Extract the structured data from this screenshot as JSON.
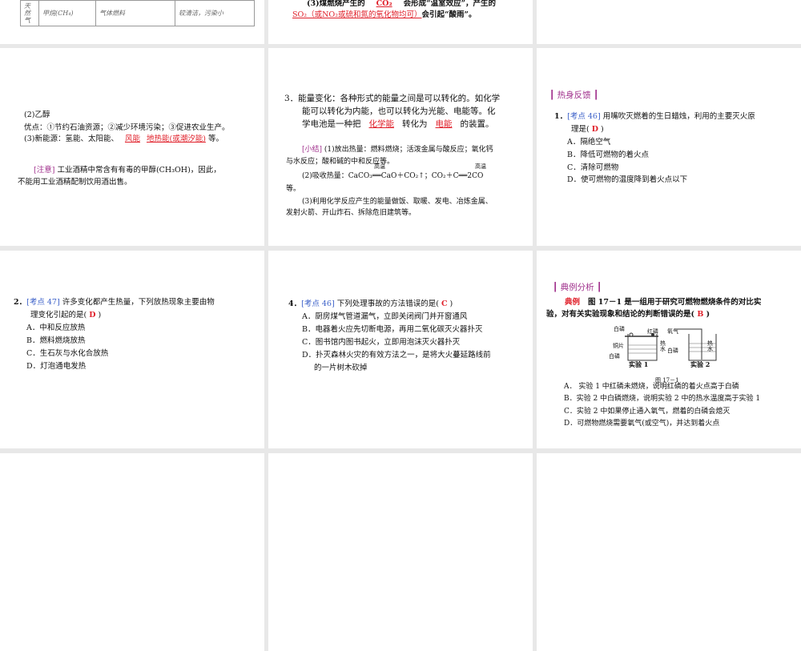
{
  "slides": {
    "s1": {
      "table": {
        "c0": "天然气",
        "c1": "甲烷(CH₄)",
        "c2": "气体燃料",
        "c3": "较清洁，污染小"
      }
    },
    "s2": {
      "pre": "(3)煤燃烧产生的",
      "a1": "CO₂",
      "mid": "会形成“温室效应”，产生的",
      "a2": "SO₂（或NO₂或硫和氮的氧化物均可）",
      "post": "会引起“酸雨”。"
    },
    "s4": {
      "l1": "(2)乙醇",
      "l2": "优点：①节约石油资源；②减少环境污染；③促进农业生产。",
      "l3pre": "(3)新能源：氢能、太阳能、",
      "a1": "风能",
      "a2": "地热能(或潮汐能)",
      "l3post": "等。",
      "note_tag": "[注意]",
      "note1": "工业酒精中常含有有毒的甲醇(CH₃OH)，因此，",
      "note2": "不能用工业酒精配制饮用酒出售。"
    },
    "s5": {
      "l1": "3．能量变化：各种形式的能量之间是可以转化的。如化学",
      "l2": "能可以转化为内能，也可以转化为光能、电能等。化",
      "l3pre": "学电池是一种把",
      "a1": "化学能",
      "l3mid": "转化为",
      "a2": "电能",
      "l3post": "的装置。",
      "sum_tag": "[小结]",
      "s1": "(1)放出热量：燃料燃烧；活泼金属与酸反应；氧化钙",
      "s1b": "与水反应；酸和碱的中和反应等。",
      "s2": "(2)吸收热量：CaCO₃══CaO＋CO₂↑；CO₂＋C══2CO",
      "cond": "高温",
      "s2b": "等。",
      "s3": "(3)利用化学反应产生的能量做饭、取暖、发电、冶炼金属、",
      "s3b": "发射火箭、开山炸石、拆除危旧建筑等。"
    },
    "s6": {
      "header": "┃ 热身反馈 ┃",
      "num": "1．",
      "tag": "[考点 46]",
      "q1": "用嘴吹灭燃着的生日蜡烛，利用的主要灭火原",
      "q2": "理是(",
      "ans": "D",
      "q2e": ")",
      "opts": [
        "A．隔绝空气",
        "B．降低可燃物的着火点",
        "C．清除可燃物",
        "D．使可燃物的温度降到着火点以下"
      ]
    },
    "s7": {
      "num": "2．",
      "tag": "[考点 47]",
      "q1": "许多变化都产生热量，下列放热现象主要由物",
      "q2": "理变化引起的是(",
      "ans": "D",
      "q2e": ")",
      "opts": [
        "A．中和反应放热",
        "B．燃料燃烧放热",
        "C．生石灰与水化合放热",
        "D．灯泡通电发热"
      ]
    },
    "s8": {
      "num": "4．",
      "tag": "[考点 46]",
      "q1": "下列处理事故的方法错误的是(",
      "ans": "C",
      "q1e": ")",
      "opts": [
        "A．厨房煤气管道漏气，立即关闭阀门并开窗通风",
        "B．电器着火应先切断电源，再用二氧化碳灭火器扑灭",
        "C．图书馆内图书起火，立即用泡沫灭火器扑灭",
        "D．扑灭森林火灾的有效方法之一，是将大火蔓延路线前"
      ],
      "opt_d2": "的一片树木砍掉"
    },
    "s9": {
      "header": "┃ 典例分析 ┃",
      "tag": "典例",
      "q1": "图 17－1 是一组用于研究可燃物燃烧条件的对比实",
      "q2": "验，对有关实验现象和结论的判断错误的是(",
      "ans": "B",
      "q2e": ")",
      "fig": {
        "bailin": "白磷",
        "honglin": "红磷",
        "tongpian": "铜片",
        "reshui": "热水",
        "yangqi": "氧气",
        "exp1": "实验 1",
        "exp2": "实验 2",
        "caption": "图 17－1"
      },
      "opts": [
        "A．  实验 1 中红磷未燃烧，说明红磷的着火点高于白磷",
        "B．实验 2 中白磷燃烧，说明实验 2 中的热水温度高于实验 1",
        "C．实验 2 中如果停止通入氧气，燃着的白磷会熄灭",
        "D．可燃物燃烧需要氧气(或空气)，并达到着火点"
      ]
    }
  }
}
